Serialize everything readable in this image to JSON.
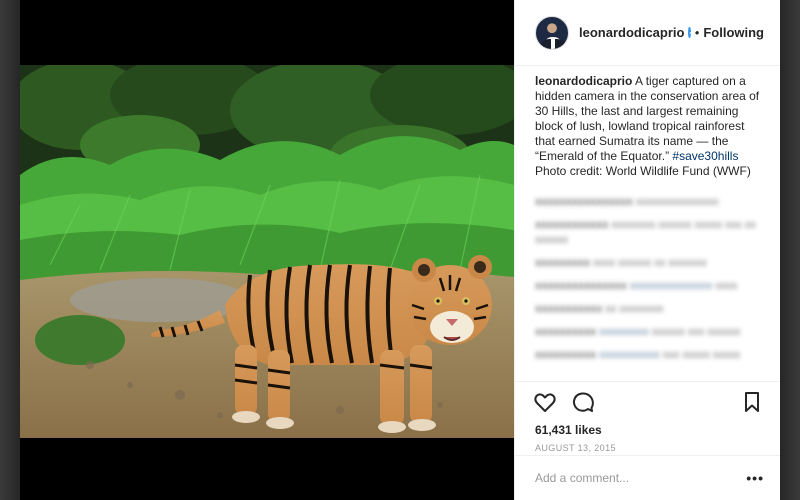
{
  "post": {
    "username": "leonardodicaprio",
    "separator": "•",
    "follow_label": "Following",
    "caption_user": "leonardodicaprio",
    "caption_text": " A tiger captured on a hidden camera in the conservation area of 30 Hills, the last and largest remaining block of lush, lowland tropical rainforest that earned Sumatra its name — the “Emerald of the Equator.” ",
    "caption_tag": "#save30hills",
    "caption_credit": "Photo credit: World Wildlife Fund (WWF)",
    "likes": "61,431 likes",
    "date": "AUGUST 13, 2015",
    "add_comment_placeholder": "Add a comment...",
    "more_label": "•••"
  },
  "icons": {
    "verified": "verified-badge-icon",
    "like": "heart-icon",
    "comment": "comment-bubble-icon",
    "save": "bookmark-icon",
    "more": "more-options-icon"
  },
  "colors": {
    "link": "#003569",
    "verified": "#3897f0",
    "muted": "#999999",
    "text": "#262626"
  }
}
